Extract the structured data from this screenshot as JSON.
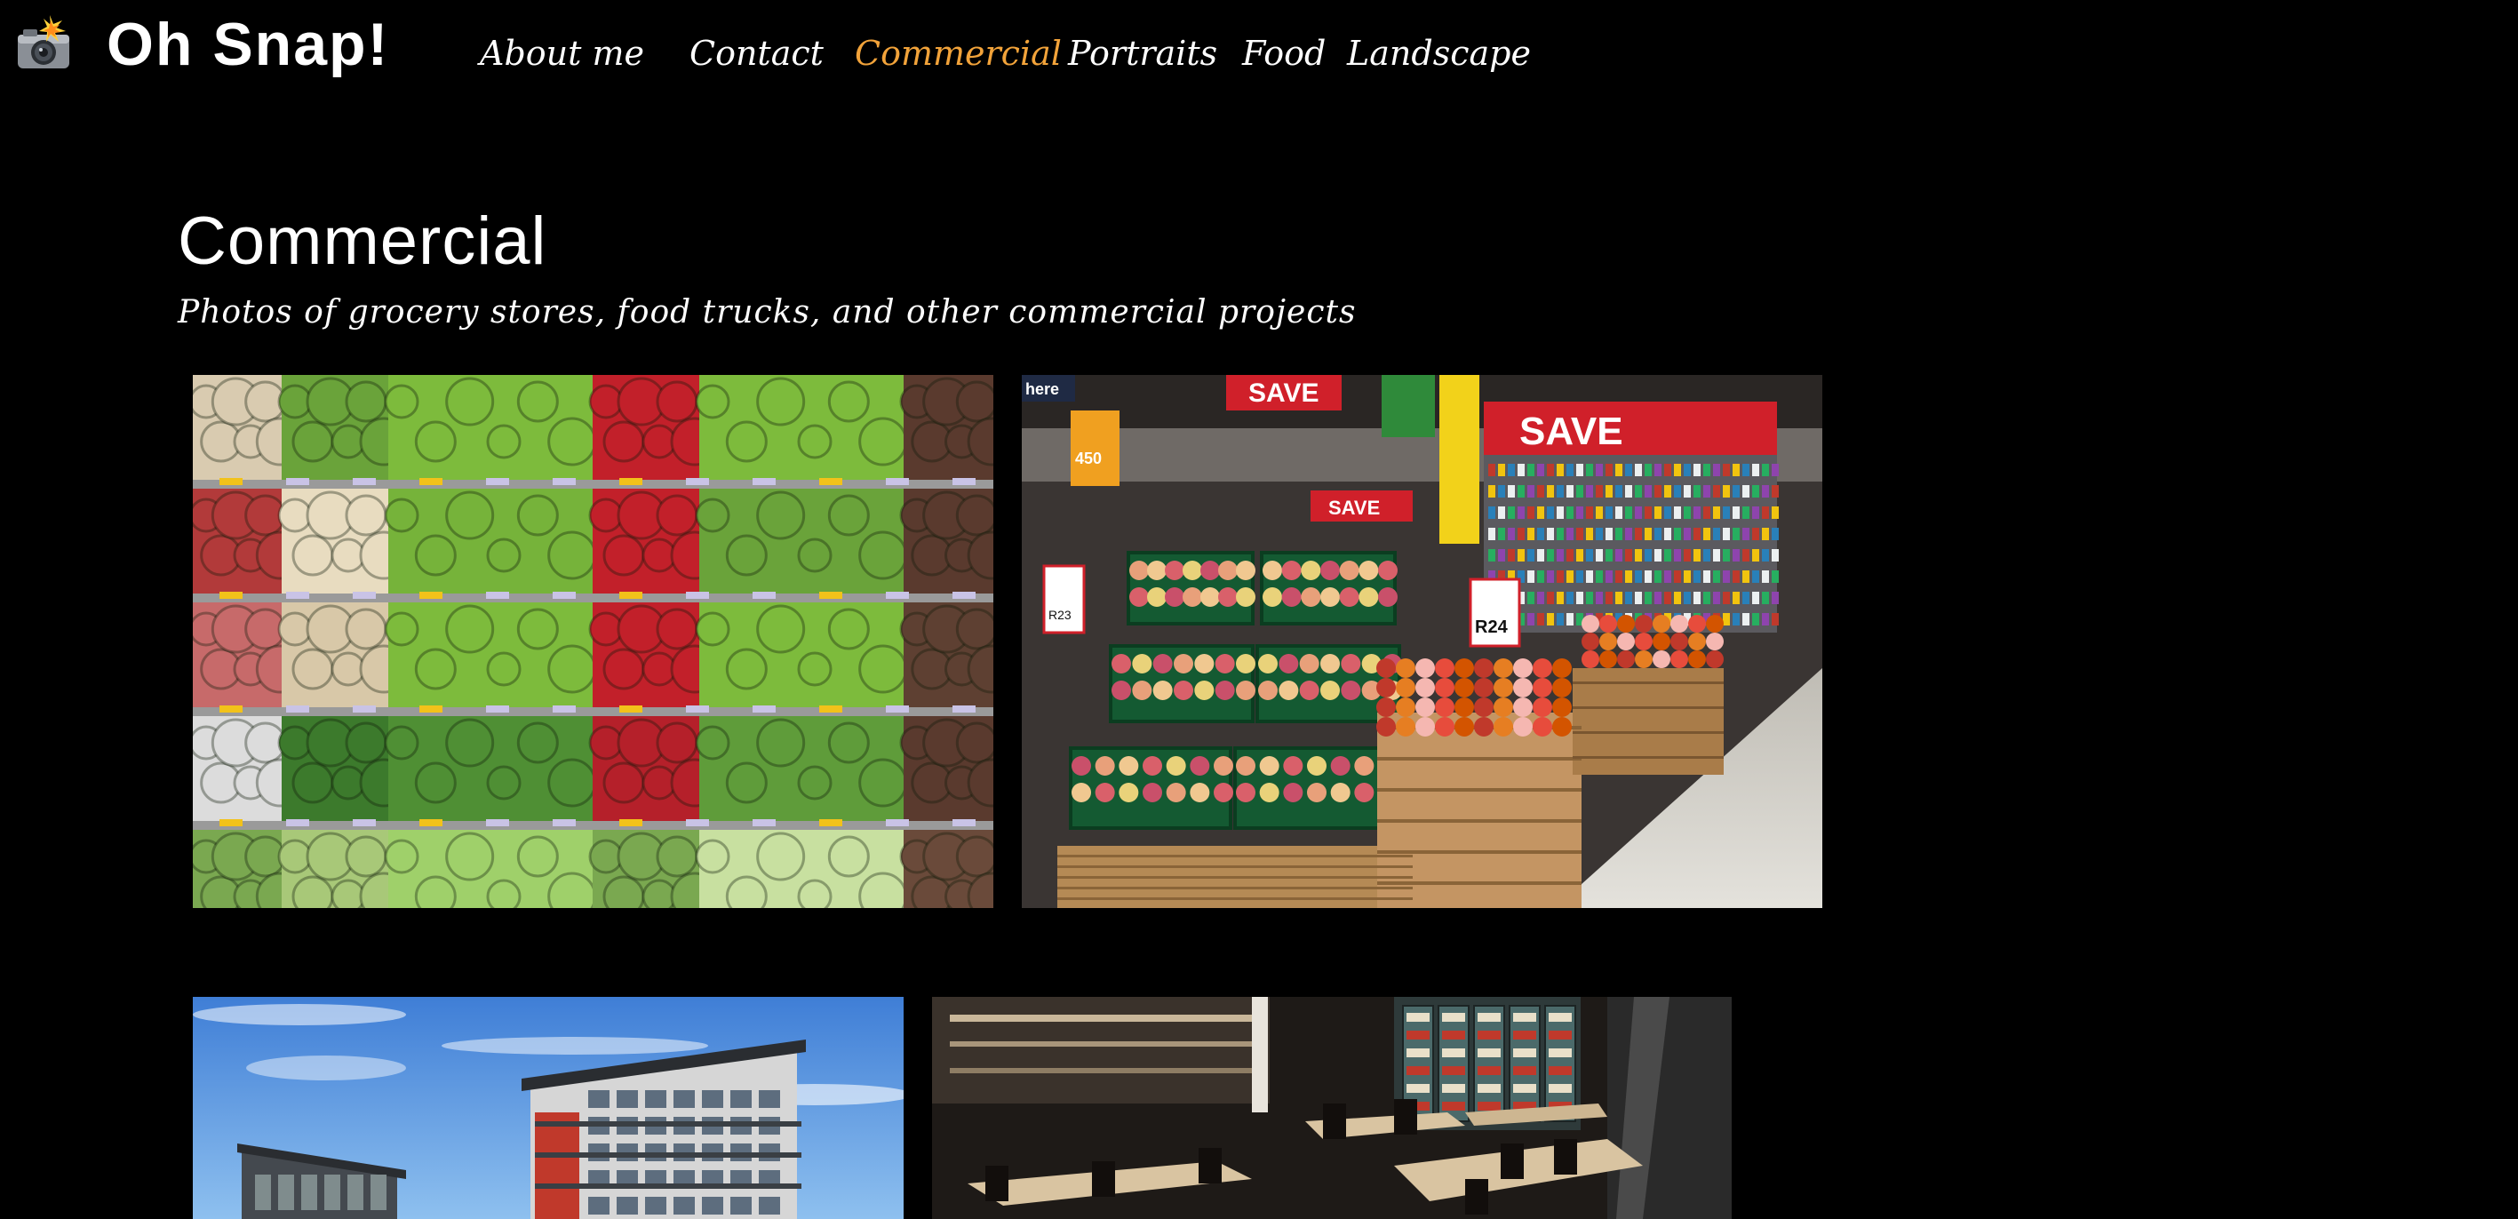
{
  "brand": {
    "icon": "camera-flash-icon",
    "title": "Oh Snap!"
  },
  "nav": {
    "items": [
      {
        "label": "About me",
        "active": false
      },
      {
        "label": "Contact",
        "active": false
      },
      {
        "label": "Commercial",
        "active": true
      },
      {
        "label": "Portraits",
        "active": false
      },
      {
        "label": "Food",
        "active": false
      },
      {
        "label": "Landscape",
        "active": false
      }
    ],
    "active_color": "#f2a33a"
  },
  "page": {
    "title": "Commercial",
    "subtitle": "Photos of grocery stores, food trucks, and other commercial projects"
  },
  "photos": {
    "grocery_produce": {
      "subject": "produce shelves"
    },
    "supermarket": {
      "subject": "supermarket fruit display",
      "signs": [
        "here",
        "SAVE",
        "450",
        "SAVE",
        "SAVE",
        "R23",
        "R24",
        "SAVE"
      ]
    },
    "apartment": {
      "subject": "apartment building"
    },
    "restaurant": {
      "subject": "restaurant interior"
    }
  },
  "colors": {
    "background": "#000000",
    "text": "#ffffff",
    "accent": "#f2a33a"
  }
}
